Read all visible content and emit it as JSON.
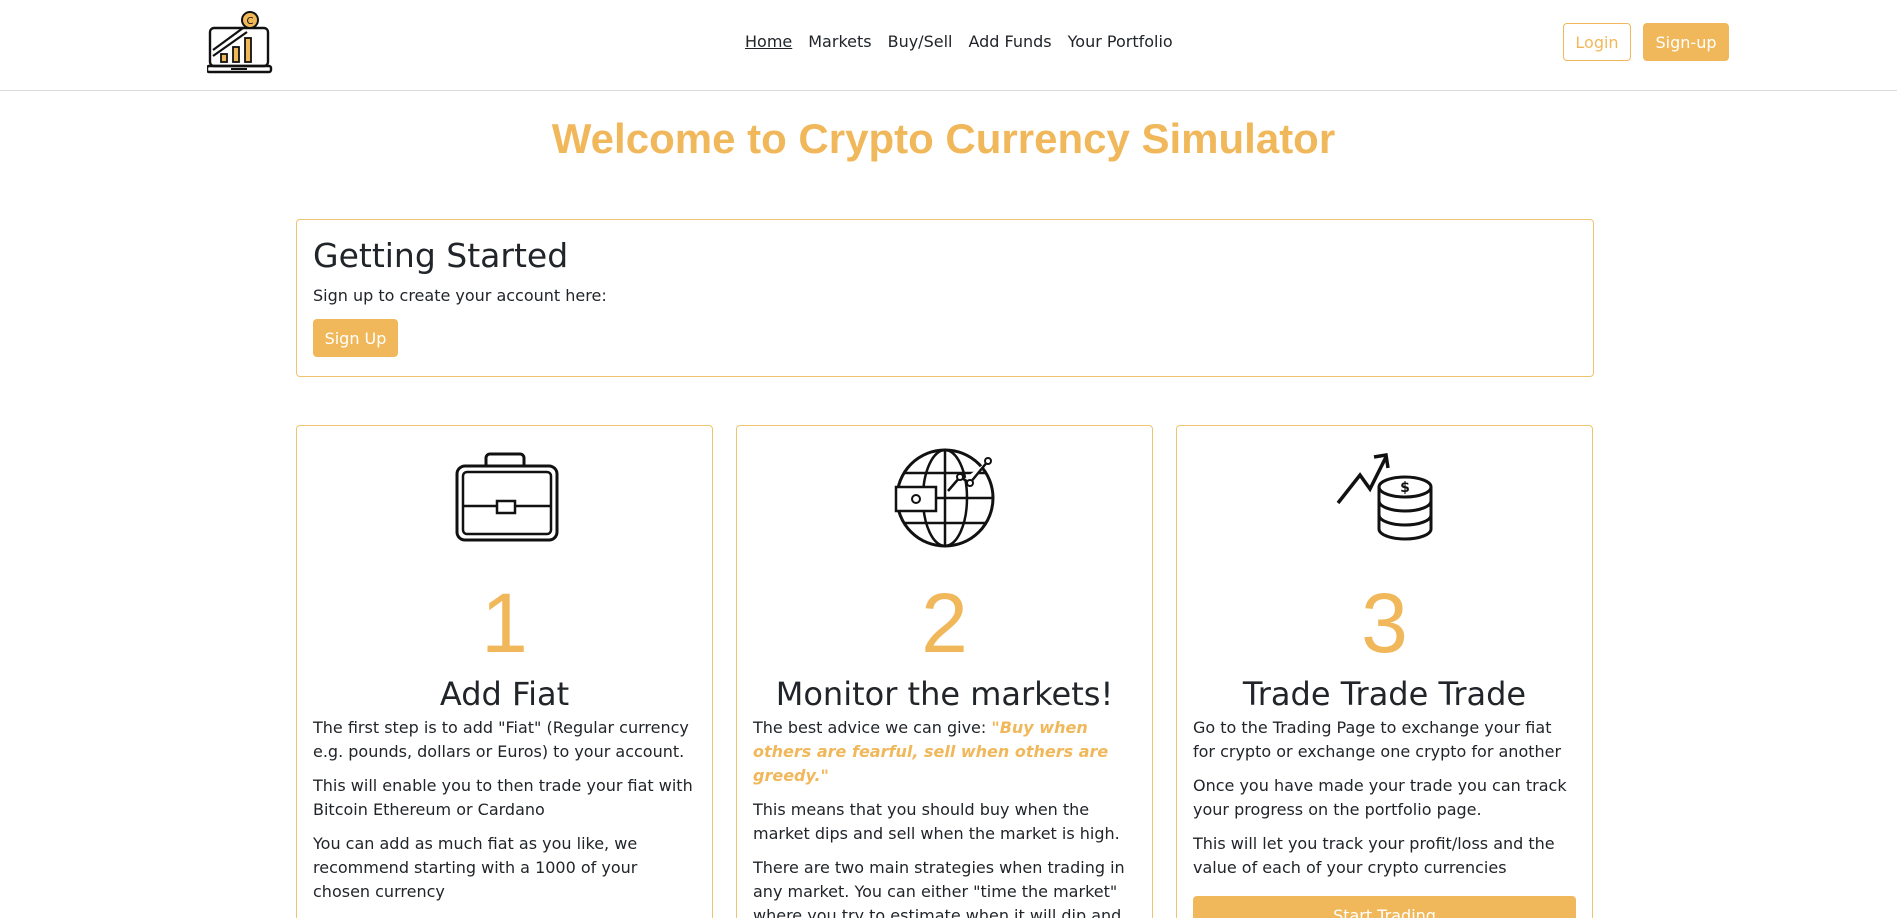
{
  "nav": {
    "links": [
      "Home",
      "Markets",
      "Buy/Sell",
      "Add Funds",
      "Your Portfolio"
    ],
    "login": "Login",
    "signup": "Sign-up"
  },
  "welcome": "Welcome to Crypto Currency Simulator",
  "getting_started": {
    "title": "Getting Started",
    "text": "Sign up to create your account here:",
    "button": "Sign Up"
  },
  "cards": [
    {
      "icon": "briefcase-icon",
      "number": "1",
      "title": "Add Fiat",
      "paragraphs": [
        "The first step is to add \"Fiat\" (Regular currency e.g. pounds, dollars or Euros) to your account.",
        "This will enable you to then trade your fiat with Bitcoin Ethereum or Cardano",
        "You can add as much fiat as you like, we recommend starting with a 1000 of your chosen currency"
      ]
    },
    {
      "icon": "globe-exchange-icon",
      "number": "2",
      "title": "Monitor the markets!",
      "intro": "The best advice we can give: ",
      "quote": "\"Buy when others are fearful, sell when others are greedy.\"",
      "paragraphs": [
        "This means that you should buy when the market dips and sell when the market is high.",
        "There are two main strategies when trading in any market. You can either \"time the market\" where you try to estimate when it will dip and rise. Or the"
      ]
    },
    {
      "icon": "coins-growth-icon",
      "number": "3",
      "title": "Trade Trade Trade",
      "paragraphs": [
        "Go to the Trading Page to exchange your fiat for crypto or exchange one crypto for another",
        "Once you have made your trade you can track your progress on the portfolio page.",
        "This will let you track your profit/loss and the value of each of your crypto currencies"
      ],
      "button": "Start Trading"
    }
  ],
  "colors": {
    "accent": "#f0b85a",
    "text": "#212529"
  }
}
